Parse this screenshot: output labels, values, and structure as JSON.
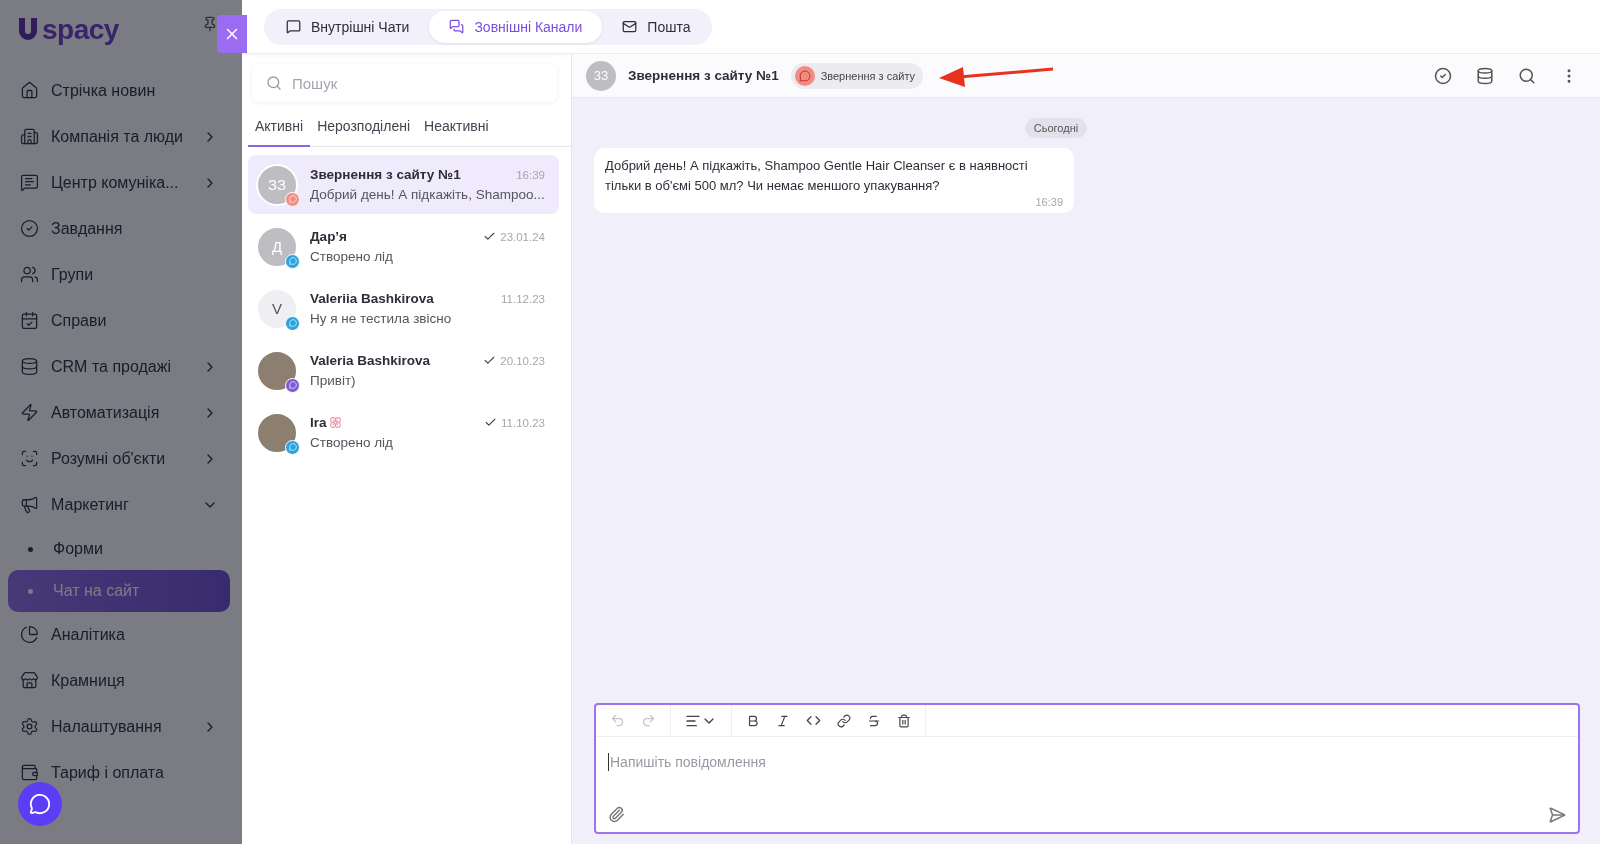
{
  "sidebar": {
    "logo": "spacy",
    "items": [
      {
        "label": "Стрічка новин",
        "kind": "link"
      },
      {
        "label": "Компанія та люди",
        "kind": "group",
        "expanded": false
      },
      {
        "label": "Центр комуніка...",
        "kind": "group",
        "expanded": false
      },
      {
        "label": "Завдання",
        "kind": "link"
      },
      {
        "label": "Групи",
        "kind": "link"
      },
      {
        "label": "Справи",
        "kind": "link"
      },
      {
        "label": "CRM та продажі",
        "kind": "group",
        "expanded": false
      },
      {
        "label": "Автоматизація",
        "kind": "group",
        "expanded": false
      },
      {
        "label": "Розумні об'єкти",
        "kind": "group",
        "expanded": false
      },
      {
        "label": "Маркетинг",
        "kind": "group",
        "expanded": true,
        "children": [
          {
            "label": "Форми",
            "selected": false
          },
          {
            "label": "Чат на сайт",
            "selected": true
          }
        ]
      },
      {
        "label": "Аналітика",
        "kind": "link"
      },
      {
        "label": "Крамниця",
        "kind": "link"
      },
      {
        "label": "Налаштування",
        "kind": "group",
        "expanded": false
      },
      {
        "label": "Тариф і оплата",
        "kind": "link"
      }
    ]
  },
  "top_tabs": [
    {
      "label": "Внутрішні Чати",
      "selected": false
    },
    {
      "label": "Зовнішні Канали",
      "selected": true
    },
    {
      "label": "Пошта",
      "selected": false
    }
  ],
  "chat_list": {
    "search": {
      "placeholder": "Пошук"
    },
    "filters": [
      {
        "label": "Активні",
        "selected": true
      },
      {
        "label": "Нерозподілені",
        "selected": false
      },
      {
        "label": "Неактивні",
        "selected": false
      }
    ],
    "chats": [
      {
        "name": "Звернення з сайту №1",
        "initials": "ЗЗ",
        "kind": "initials",
        "color": "#f28b82",
        "preview": "Добрий день! А підкажіть, Shampoo...",
        "time": "16:39",
        "read": false,
        "selected": true
      },
      {
        "name": "Дар’я",
        "initials": "Д",
        "kind": "initials",
        "color": "#2aa3e0",
        "preview": "Створено лід",
        "time": "23.01.24",
        "read": true,
        "selected": false
      },
      {
        "name": "Valeriia Bashkirova",
        "initials": "V",
        "kind": "light",
        "color": "#2aa3e0",
        "preview": "Ну я не тестила звісно",
        "time": "11.12.23",
        "read": false,
        "selected": false
      },
      {
        "name": "Valeria Bashkirova",
        "kind": "photo",
        "color": "#7c5cd6",
        "preview": "Привіт)",
        "time": "20.10.23",
        "read": true,
        "selected": false
      },
      {
        "name": "Ira",
        "kind": "photo",
        "color": "#2aa3e0",
        "preview": "Створено лід",
        "time": "11.10.23",
        "read": true,
        "selected": false
      }
    ]
  },
  "conversation": {
    "initials": "ЗЗ",
    "title": "Звернення з сайту №1",
    "source": "Звернення з сайту",
    "date_divider": "Сьогодні",
    "messages": [
      {
        "text": "Добрий день! А підкажіть, Shampoo Gentle Hair Cleanser є в наявності тільки в об'ємі 500 мл? Чи немає меншого упакування?",
        "time": "16:39"
      }
    ],
    "composer": {
      "placeholder": "Напишіть повідомлення"
    }
  }
}
